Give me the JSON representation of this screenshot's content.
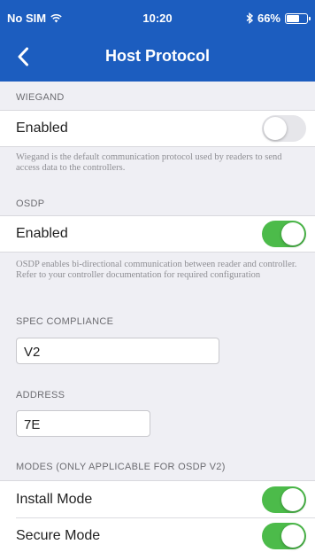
{
  "status_bar": {
    "carrier": "No SIM",
    "wifi_icon": "wifi-icon",
    "time": "10:20",
    "bluetooth_icon": "bluetooth-icon",
    "battery_text": "66%",
    "battery_level": 0.66
  },
  "nav": {
    "title": "Host Protocol",
    "back_icon": "chevron-left-icon"
  },
  "wiegand": {
    "header": "WIEGAND",
    "enabled_label": "Enabled",
    "enabled": false,
    "footnote": "Wiegand is the default communication protocol used by readers to send access data to the controllers."
  },
  "osdp": {
    "header": "OSDP",
    "enabled_label": "Enabled",
    "enabled": true,
    "footnote": "OSDP enables bi-directional communication between reader and controller. Refer to your controller documentation for required configuration"
  },
  "spec_compliance": {
    "header": "SPEC COMPLIANCE",
    "value": "V2"
  },
  "address": {
    "header": "ADDRESS",
    "value": "7E"
  },
  "modes": {
    "header": "MODES (ONLY APPLICABLE FOR OSDP V2)",
    "install_label": "Install Mode",
    "install_enabled": true,
    "secure_label": "Secure Mode",
    "secure_enabled": true
  },
  "colors": {
    "nav_blue": "#1c5dbf",
    "toggle_on": "#4cbb4a",
    "toggle_off": "#e6e6ea",
    "background": "#efeff4"
  }
}
